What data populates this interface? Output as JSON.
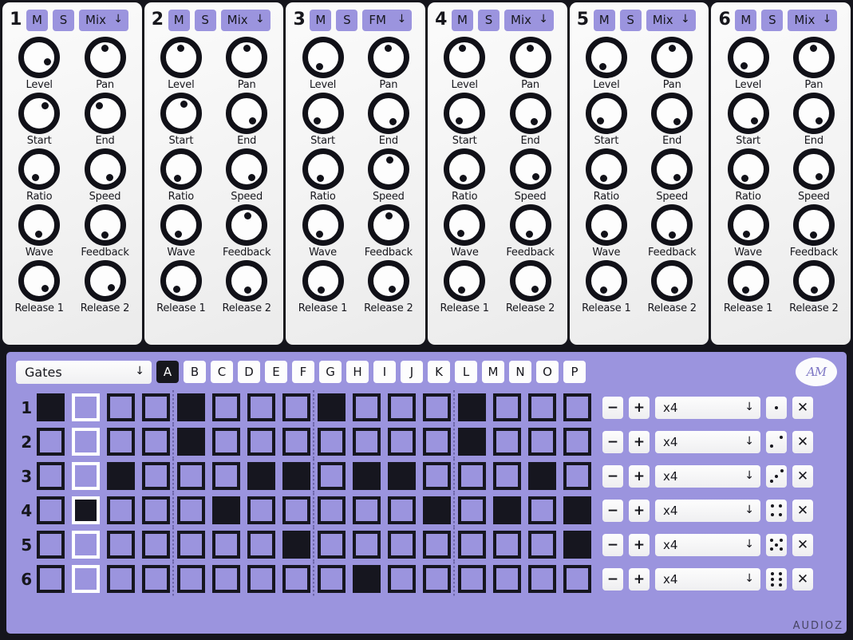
{
  "channels": [
    {
      "number": "1",
      "mute_label": "M",
      "solo_label": "S",
      "mode_label": "Mix",
      "knobs": [
        {
          "label": "Level",
          "angle": 120
        },
        {
          "label": "Pan",
          "angle": 0
        },
        {
          "label": "Start",
          "angle": 35
        },
        {
          "label": "End",
          "angle": 325
        },
        {
          "label": "Ratio",
          "angle": 205
        },
        {
          "label": "Speed",
          "angle": 150
        },
        {
          "label": "Wave",
          "angle": 185
        },
        {
          "label": "Feedback",
          "angle": 180
        },
        {
          "label": "Release 1",
          "angle": 140
        },
        {
          "label": "Release 2",
          "angle": 135
        }
      ]
    },
    {
      "number": "2",
      "mute_label": "M",
      "solo_label": "S",
      "mode_label": "Mix",
      "knobs": [
        {
          "label": "Level",
          "angle": 0
        },
        {
          "label": "Pan",
          "angle": 0
        },
        {
          "label": "Start",
          "angle": 20
        },
        {
          "label": "End",
          "angle": 145
        },
        {
          "label": "Ratio",
          "angle": 200
        },
        {
          "label": "Speed",
          "angle": 150
        },
        {
          "label": "Wave",
          "angle": 195
        },
        {
          "label": "Feedback",
          "angle": 5
        },
        {
          "label": "Release 1",
          "angle": 205
        },
        {
          "label": "Release 2",
          "angle": 175
        }
      ]
    },
    {
      "number": "3",
      "mute_label": "M",
      "solo_label": "S",
      "mode_label": "FM",
      "knobs": [
        {
          "label": "Level",
          "angle": 200
        },
        {
          "label": "Pan",
          "angle": 0
        },
        {
          "label": "Start",
          "angle": 215
        },
        {
          "label": "End",
          "angle": 150
        },
        {
          "label": "Ratio",
          "angle": 195
        },
        {
          "label": "Speed",
          "angle": 10
        },
        {
          "label": "Wave",
          "angle": 200
        },
        {
          "label": "Feedback",
          "angle": 5
        },
        {
          "label": "Release 1",
          "angle": 190
        },
        {
          "label": "Release 2",
          "angle": 155
        }
      ]
    },
    {
      "number": "4",
      "mute_label": "M",
      "solo_label": "S",
      "mode_label": "Mix",
      "knobs": [
        {
          "label": "Level",
          "angle": 345
        },
        {
          "label": "Pan",
          "angle": 0
        },
        {
          "label": "Start",
          "angle": 215
        },
        {
          "label": "End",
          "angle": 155
        },
        {
          "label": "Ratio",
          "angle": 190
        },
        {
          "label": "Speed",
          "angle": 145
        },
        {
          "label": "Wave",
          "angle": 205
        },
        {
          "label": "Feedback",
          "angle": 185
        },
        {
          "label": "Release 1",
          "angle": 200
        },
        {
          "label": "Release 2",
          "angle": 150
        }
      ]
    },
    {
      "number": "5",
      "mute_label": "M",
      "solo_label": "S",
      "mode_label": "Mix",
      "knobs": [
        {
          "label": "Level",
          "angle": 200
        },
        {
          "label": "Pan",
          "angle": 0
        },
        {
          "label": "Start",
          "angle": 215
        },
        {
          "label": "End",
          "angle": 150
        },
        {
          "label": "Ratio",
          "angle": 195
        },
        {
          "label": "Speed",
          "angle": 150
        },
        {
          "label": "Wave",
          "angle": 190
        },
        {
          "label": "Feedback",
          "angle": 180
        },
        {
          "label": "Release 1",
          "angle": 195
        },
        {
          "label": "Release 2",
          "angle": 165
        }
      ]
    },
    {
      "number": "6",
      "mute_label": "M",
      "solo_label": "S",
      "mode_label": "Mix",
      "knobs": [
        {
          "label": "Level",
          "angle": 205
        },
        {
          "label": "Pan",
          "angle": 0
        },
        {
          "label": "Start",
          "angle": 140
        },
        {
          "label": "End",
          "angle": 145
        },
        {
          "label": "Ratio",
          "angle": 200
        },
        {
          "label": "Speed",
          "angle": 145
        },
        {
          "label": "Wave",
          "angle": 190
        },
        {
          "label": "Feedback",
          "angle": 180
        },
        {
          "label": "Release 1",
          "angle": 195
        },
        {
          "label": "Release 2",
          "angle": 175
        }
      ]
    }
  ],
  "sequencer": {
    "mode_select": {
      "value": "Gates"
    },
    "patterns": [
      "A",
      "B",
      "C",
      "D",
      "E",
      "F",
      "G",
      "H",
      "I",
      "J",
      "K",
      "L",
      "M",
      "N",
      "O",
      "P"
    ],
    "active_pattern": "A",
    "logo_text": "AM",
    "playhead_step": 2,
    "step_count": 16,
    "row_labels": [
      "1",
      "2",
      "3",
      "4",
      "5",
      "6"
    ],
    "minus_label": "−",
    "plus_label": "+",
    "clear_label": "✕",
    "multiplier_value": "x4",
    "rows": [
      {
        "label": "1",
        "steps": [
          1,
          0,
          0,
          0,
          1,
          0,
          0,
          0,
          1,
          0,
          0,
          0,
          1,
          0,
          0,
          0
        ],
        "multiplier": "x4",
        "dice": 1
      },
      {
        "label": "2",
        "steps": [
          0,
          0,
          0,
          0,
          1,
          0,
          0,
          0,
          0,
          0,
          0,
          0,
          1,
          0,
          0,
          0
        ],
        "multiplier": "x4",
        "dice": 2
      },
      {
        "label": "3",
        "steps": [
          0,
          0,
          1,
          0,
          0,
          0,
          1,
          1,
          0,
          1,
          1,
          0,
          0,
          0,
          1,
          0
        ],
        "multiplier": "x4",
        "dice": 3
      },
      {
        "label": "4",
        "steps": [
          0,
          1,
          0,
          0,
          0,
          1,
          0,
          0,
          0,
          0,
          0,
          1,
          0,
          1,
          0,
          1
        ],
        "multiplier": "x4",
        "dice": 4
      },
      {
        "label": "5",
        "steps": [
          0,
          0,
          0,
          0,
          0,
          0,
          0,
          1,
          0,
          0,
          0,
          0,
          0,
          0,
          0,
          1
        ],
        "multiplier": "x4",
        "dice": 5
      },
      {
        "label": "6",
        "steps": [
          0,
          0,
          0,
          0,
          0,
          0,
          0,
          0,
          0,
          1,
          0,
          0,
          0,
          0,
          0,
          0
        ],
        "multiplier": "x4",
        "dice": 6
      }
    ],
    "watermark": "AUDIOZ"
  },
  "colors": {
    "accent": "#9b94de",
    "dark": "#16161f",
    "panel": "#f5f5f6",
    "shell": "#15151c",
    "white": "#fdfdfd"
  }
}
